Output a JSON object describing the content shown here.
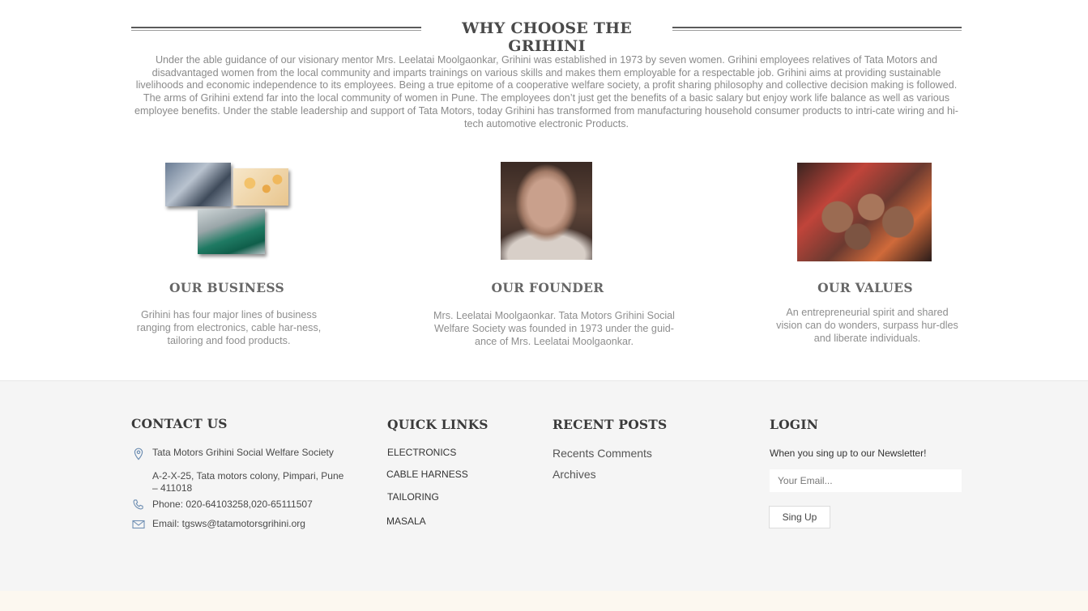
{
  "why": {
    "heading": "WHY CHOOSE THE GRIHINI",
    "intro": "Under the able guidance of our visionary mentor Mrs. Leelatai Moolgaonkar, Grihini was established in 1973 by seven women. Grihini employees relatives of Tata Motors and disadvantaged women from the local community and imparts trainings on various skills and makes them employable for a respectable job. Grihini aims at providing sustainable livelihoods and economic independence to its employees. Being a true epitome of a cooperative welfare society, a profit sharing philosophy and collective decision making is followed. The arms of Grihini extend far into the local community of women in Pune. The employees don’t just get the benefits of a basic salary but enjoy work life balance as well as various employee benefits. Under the stable leadership and support of Tata Motors, today Grihini has transformed from manufacturing household consumer products to intri-cate wiring and hi-tech automotive electronic Products.",
    "features": [
      {
        "title": "OUR BUSINESS",
        "text": "Grihini has four major lines of business ranging from electronics, cable har-ness, tailoring and food products."
      },
      {
        "title": "OUR FOUNDER",
        "text": "Mrs. Leelatai Moolgaonkar. Tata Motors Grihini Social Welfare Society was founded in 1973 under the guid-ance of Mrs. Leelatai Moolgaonkar."
      },
      {
        "title": "OUR VALUES",
        "text": "An entrepreneurial spirit and shared vision can do wonders, surpass hur-dles and liberate individuals."
      }
    ]
  },
  "footer": {
    "contact": {
      "title": "CONTACT US",
      "org": "Tata Motors Grihini Social Welfare Society",
      "address": "A-2-X-25, Tata motors colony, Pimpari, Pune – 411018",
      "phone": "Phone:  020-64103258,020-65111507",
      "email": "Email: tgsws@tatamotorsgrihini.org"
    },
    "quick_links": {
      "title": "QUICK LINKS",
      "items": [
        "ELECTRONICS",
        "CABLE HARNESS",
        "TAILORING",
        "MASALA"
      ]
    },
    "recent_posts": {
      "title": "RECENT POSTS",
      "items": [
        "Recents Comments",
        "Archives"
      ]
    },
    "login": {
      "title": "LOGIN",
      "text": "When you sing up to our Newsletter!",
      "email_placeholder": "Your Email...",
      "button": "Sing Up"
    }
  },
  "colors": {
    "footer_bg": "#f5f5f5",
    "bottom_strip": "#fcf8f0",
    "icon_blue": "#6f8fb3"
  },
  "icons": {
    "location": "location-pin-icon",
    "phone": "phone-icon",
    "email": "envelope-icon"
  }
}
